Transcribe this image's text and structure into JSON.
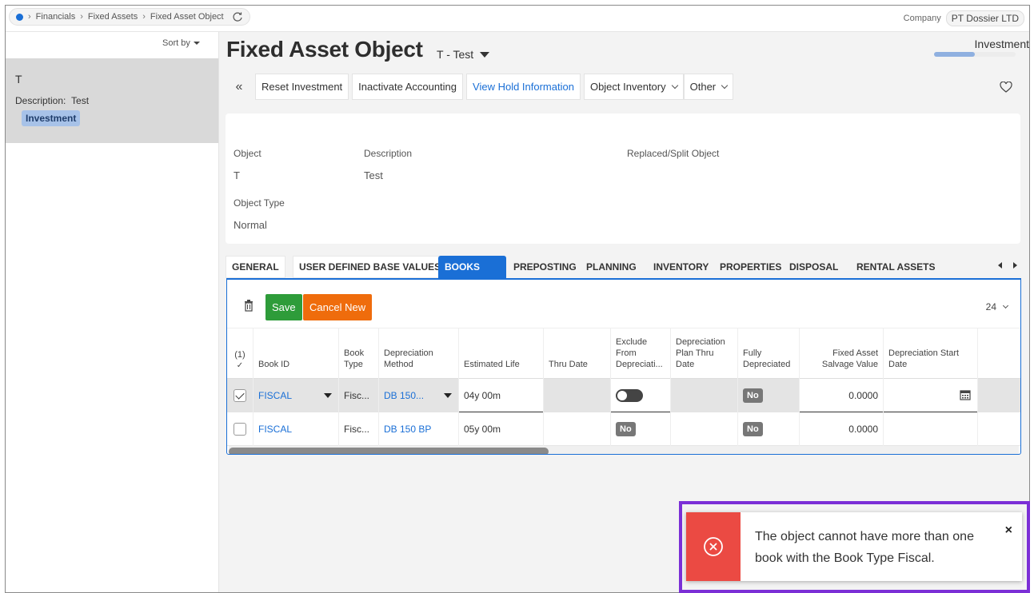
{
  "breadcrumb": {
    "items": [
      "Financials",
      "Fixed Assets",
      "Fixed Asset Object"
    ]
  },
  "company": {
    "label": "Company",
    "value": "PT Dossier LTD"
  },
  "left_pane": {
    "sort_by": "Sort by",
    "record": {
      "title": "T",
      "description_label": "Description:",
      "description_value": "Test",
      "status_badge": "Investment"
    }
  },
  "header": {
    "title": "Fixed Asset Object",
    "subtitle": "T - Test",
    "status": "Investment",
    "status_progress": 0.5
  },
  "toolbar": {
    "reset": "Reset Investment",
    "inactivate": "Inactivate Accounting",
    "hold": "View Hold Information",
    "inventory": "Object Inventory",
    "other": "Other"
  },
  "info": {
    "object_label": "Object",
    "object_value": "T",
    "description_label": "Description",
    "description_value": "Test",
    "replaced_label": "Replaced/Split Object",
    "type_label": "Object Type",
    "type_value": "Normal"
  },
  "tabs": [
    "GENERAL",
    "USER DEFINED BASE VALUES",
    "BOOKS",
    "PREPOSTING",
    "PLANNING",
    "INVENTORY",
    "PROPERTIES",
    "DISPOSAL",
    "RENTAL ASSETS"
  ],
  "active_tab": "BOOKS",
  "grid": {
    "save": "Save",
    "cancel": "Cancel New",
    "page_size": "24",
    "selected_count": "(1)",
    "columns": {
      "book_id": "Book ID",
      "book_type": "Book Type",
      "dep_method": "Depreciation Method",
      "est_life": "Estimated Life",
      "thru_date": "Thru Date",
      "exclude": "Exclude From Depreciati...",
      "plan_thru": "Depreciation Plan Thru Date",
      "fully": "Fully Depreciated",
      "salvage": "Fixed Asset Salvage Value",
      "start_date": "Depreciation Start Date"
    },
    "rows": [
      {
        "book_id": "FISCAL",
        "book_type": "Fisc...",
        "dep_method": "DB 150...",
        "est_life": "04y 00m",
        "exclude": "",
        "fully": "No",
        "salvage": "0.0000"
      },
      {
        "book_id": "FISCAL",
        "book_type": "Fisc...",
        "dep_method": "DB 150 BP",
        "est_life": "05y 00m",
        "exclude": "No",
        "fully": "No",
        "salvage": "0.0000"
      }
    ]
  },
  "toast": {
    "message": "The object cannot have more than one book with the Book Type Fiscal.",
    "close": "×"
  },
  "colors": {
    "accent": "#1a6fd6",
    "save": "#2e9c3a",
    "cancel": "#ef6c0c",
    "error": "#eb4a43",
    "highlight": "#7b2fd6"
  }
}
